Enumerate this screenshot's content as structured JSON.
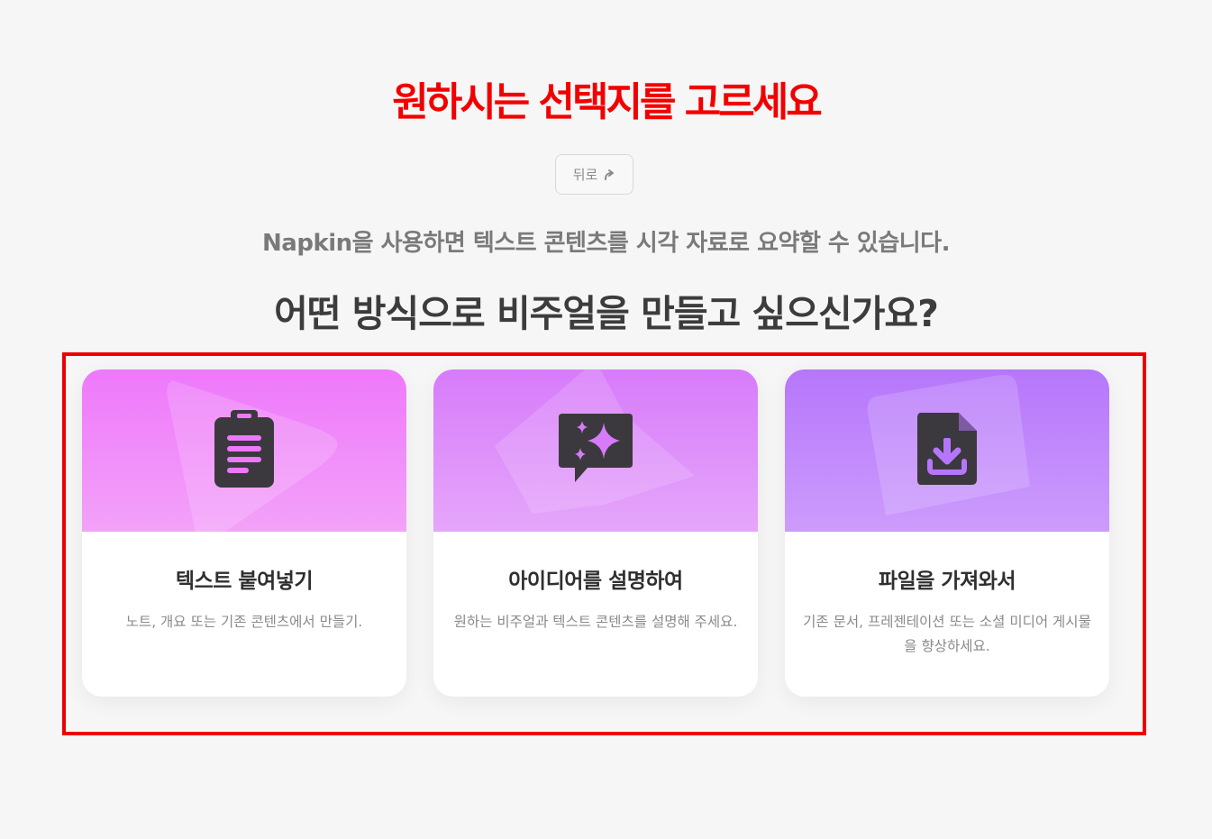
{
  "annotation": {
    "title": "원하시는 선택지를 고르세요",
    "color": "#f20000"
  },
  "back_button": {
    "label": "뒤로",
    "icon": "arrow-up-right-icon"
  },
  "subtitle": "Napkin을 사용하면 텍스트 콘텐츠를 시각 자료로 요약할 수 있습니다.",
  "question": "어떤 방식으로 비주얼을 만들고 싶으신가요?",
  "options": [
    {
      "title": "텍스트 붙여넣기",
      "description": "노트, 개요 또는 기존 콘텐츠에서 만들기.",
      "icon": "clipboard-icon",
      "gradient": [
        "#ee78fb",
        "#f3a2f9"
      ]
    },
    {
      "title": "아이디어를 설명하여",
      "description": "원하는 비주얼과 텍스트 콘텐츠를 설명해 주세요.",
      "icon": "sparkle-chat-icon",
      "gradient": [
        "#d77bfa",
        "#e5a6fa"
      ]
    },
    {
      "title": "파일을 가져와서",
      "description": "기존 문서, 프레젠테이션 또는 소셜 미디어 게시물을 향상하세요.",
      "icon": "file-download-icon",
      "gradient": [
        "#b676fb",
        "#cc9cfc"
      ]
    }
  ],
  "colors": {
    "background": "#f6f6f6",
    "icon_fill": "#3b393d",
    "highlight_border": "#ee0000"
  }
}
